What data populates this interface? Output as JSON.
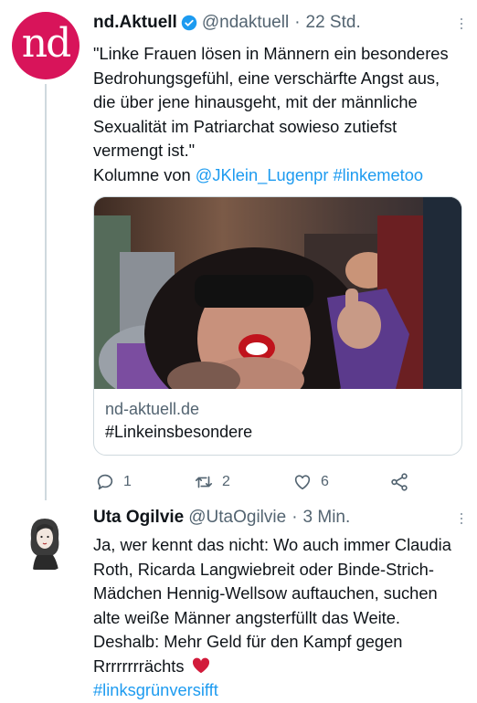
{
  "tweet1": {
    "avatar_text": "nd",
    "author_name": "nd.Aktuell",
    "handle": "@ndaktuell",
    "separator": "·",
    "time": "22 Std.",
    "text_line1": "\"Linke Frauen lösen in Männern ein besonderes Bedrohungsgefühl, eine verschärfte Angst aus, die über jene hinausgeht, mit der männliche Sexualität im Patriarchat sowieso zutiefst vermengt ist.\"",
    "text_prefix": "Kolumne von ",
    "mention": "@JKlein_Lugenpr",
    "hashtag": "#linkemetoo",
    "card": {
      "domain": "nd-aktuell.de",
      "title": "#Linkeinsbesondere"
    },
    "replies": "1",
    "retweets": "2",
    "likes": "6",
    "colors": {
      "brand": "#d8145a",
      "verified": "#1d9bf0",
      "link": "#1d9bf0"
    }
  },
  "tweet2": {
    "author_name": "Uta Ogilvie",
    "handle": "@UtaOgilvie",
    "separator": "·",
    "time": "3 Min.",
    "text": "Ja, wer kennt das nicht: Wo auch immer Claudia Roth, Ricarda Langwiebreit oder Binde-Strich-Mädchen Hennig-Wellsow auftauchen, suchen alte weiße Männer angsterfüllt das Weite. Deshalb: Mehr Geld für den Kampf gegen Rrrrrrrrächts",
    "emoji": "❤️",
    "hashtag": "#linksgrünversifft"
  },
  "icons": [
    "more-icon",
    "verified-badge-icon",
    "reply-icon",
    "retweet-icon",
    "like-icon",
    "share-icon",
    "heart-emoji-icon"
  ]
}
